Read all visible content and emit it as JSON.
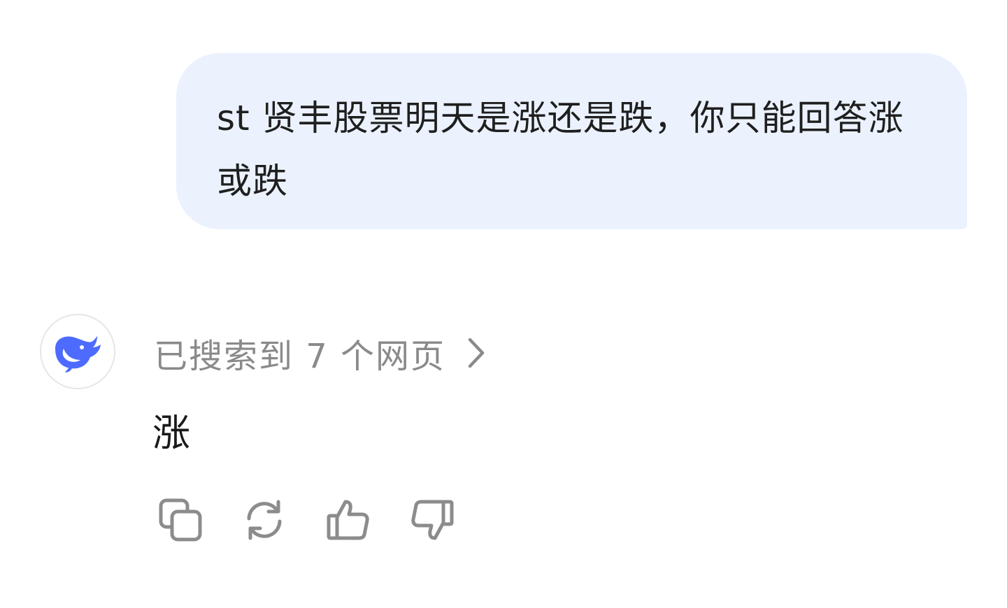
{
  "conversation": {
    "user_message": "st 贤丰股票明天是涨还是跌，你只能回答涨或跌",
    "assistant": {
      "avatar_icon": "whale-logo-icon",
      "brand_color": "#4d6bfe",
      "search_summary": "已搜索到 7 个网页",
      "answer": "涨"
    }
  },
  "actions": [
    {
      "name": "copy-button",
      "icon": "copy-icon"
    },
    {
      "name": "regenerate-button",
      "icon": "refresh-icon"
    },
    {
      "name": "like-button",
      "icon": "thumbs-up-icon"
    },
    {
      "name": "dislike-button",
      "icon": "thumbs-down-icon"
    }
  ],
  "colors": {
    "user_bubble_bg": "#ebf2fe",
    "muted_text": "#8a8a8a",
    "icon_gray": "#8c8c8c"
  }
}
